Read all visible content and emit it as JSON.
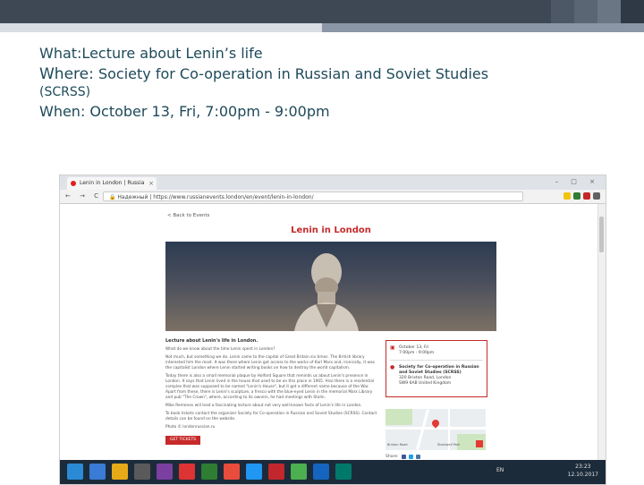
{
  "heading": {
    "what": "What:Lecture about Lenin’s life",
    "where_label": "Where:",
    "where_value": "Society for Co-operation in Russian and Soviet Studies",
    "where_abbr": "(SCRSS)",
    "when": "When: October 13, Fri, 7:00pm - 9:00pm"
  },
  "browser": {
    "tab_title": "Lenin in London | Russia",
    "tab_close": "×",
    "window_controls": "– □ ×",
    "nav_buttons": "← → C ⌂",
    "url_secure": "Надежный",
    "url": "https://www.russianevents.london/en/event/lenin-in-london/"
  },
  "page": {
    "back_link": "< Back to Events",
    "title": "Lenin in London",
    "article_heading": "Lecture about Lenin's life in London.",
    "paragraphs": [
      "What do we know about the time Lenin spent in London?",
      "Not much, but something we do. Lenin came to the capital of Great Britain six times. The British library interested him the most. It was there where Lenin got access to the works of Karl Marx and, ironically, it was the capitalist London where Lenin started writing books on how to destroy the world capitalism.",
      "Today there is also a small memorial plaque by Holford Square that reminds us about Lenin's presence in London. It says that Lenin lived in the house that used to be on this place in 1905. Also there is a residential complex that was supposed to be named \"Lenin's House\", but it got a different name because of the War. Apart from these, there is Lenin's sculpture, a fresco with the blue-eyed Lenin in the memorial Marx Library and pub \"The Crown\", where, according to its owners, he had meetings with Stalin.",
      "Mike Remenov will lead a fascinating lecture about not very well-known facts of Lenin's life in London.",
      "To book tickets contact the organizer Society for Co-operation in Russian and Soviet Studies (SCRSS). Contact details can be found on the website.",
      "Photo © londonrussian.ru"
    ],
    "buy_button": "GET TICKETS",
    "info_date": "October 13, Fri",
    "info_time": "7:00pm - 9:00pm",
    "info_venue": "Society for Co-operation in Russian and Soviet Studies (SCRSS)",
    "info_address_1": "320 Brixton Road, London",
    "info_address_2": "SW9 6AB United Kingdom",
    "share_label": "Share:",
    "map_labels": [
      "Brixton Road",
      "Stockwell Park"
    ]
  },
  "taskbar": {
    "lang": "EN",
    "time": "23:23",
    "date": "12.10.2017"
  },
  "colors": {
    "accent_red": "#c62a2a",
    "heading_text": "#1e4a5a",
    "slide_bar": "#3e4855",
    "taskbar": "#1c2b3a"
  }
}
